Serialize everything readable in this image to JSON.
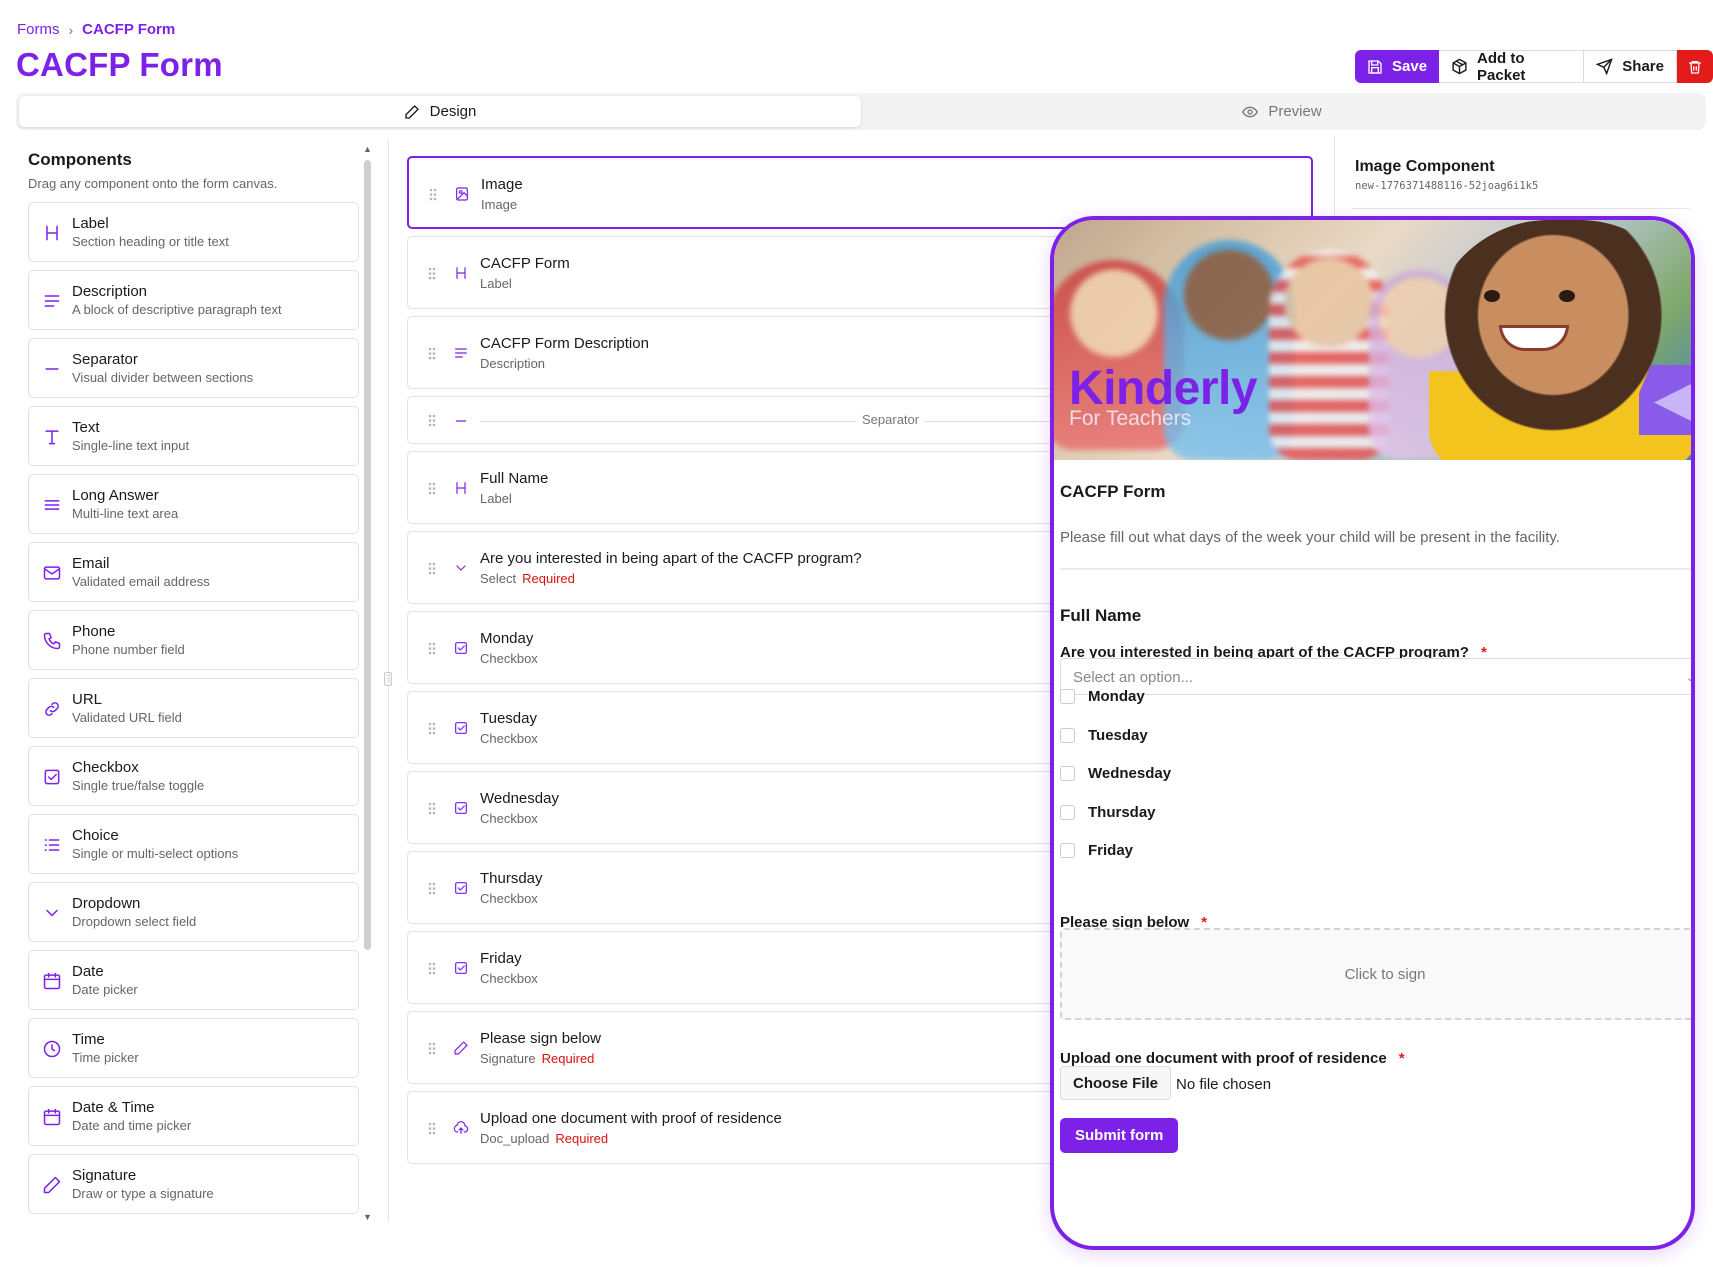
{
  "breadcrumb": {
    "parent": "Forms",
    "current": "CACFP Form"
  },
  "page_title": "CACFP Form",
  "actions": {
    "save": "Save",
    "add_to_packet": "Add to Packet",
    "share": "Share"
  },
  "tabs": {
    "design": "Design",
    "preview": "Preview",
    "active": "design"
  },
  "components": {
    "title": "Components",
    "subtitle": "Drag any component onto the form canvas.",
    "items": [
      {
        "name": "Label",
        "desc": "Section heading or title text",
        "icon": "heading-icon"
      },
      {
        "name": "Description",
        "desc": "A block of descriptive paragraph text",
        "icon": "paragraph-icon"
      },
      {
        "name": "Separator",
        "desc": "Visual divider between sections",
        "icon": "separator-icon"
      },
      {
        "name": "Text",
        "desc": "Single-line text input",
        "icon": "text-icon"
      },
      {
        "name": "Long Answer",
        "desc": "Multi-line text area",
        "icon": "lines-icon"
      },
      {
        "name": "Email",
        "desc": "Validated email address",
        "icon": "mail-icon"
      },
      {
        "name": "Phone",
        "desc": "Phone number field",
        "icon": "phone-icon"
      },
      {
        "name": "URL",
        "desc": "Validated URL field",
        "icon": "link-icon"
      },
      {
        "name": "Checkbox",
        "desc": "Single true/false toggle",
        "icon": "checkbox-icon"
      },
      {
        "name": "Choice",
        "desc": "Single or multi-select options",
        "icon": "list-icon"
      },
      {
        "name": "Dropdown",
        "desc": "Dropdown select field",
        "icon": "chevron-down-icon"
      },
      {
        "name": "Date",
        "desc": "Date picker",
        "icon": "calendar-icon"
      },
      {
        "name": "Time",
        "desc": "Time picker",
        "icon": "clock-icon"
      },
      {
        "name": "Date & Time",
        "desc": "Date and time picker",
        "icon": "calendar-icon"
      },
      {
        "name": "Signature",
        "desc": "Draw or type a signature",
        "icon": "pen-icon"
      }
    ]
  },
  "canvas": {
    "fields": [
      {
        "name": "Image",
        "type": "Image",
        "icon": "image-icon",
        "selected": true
      },
      {
        "name": "CACFP Form",
        "type": "Label",
        "icon": "heading-icon"
      },
      {
        "name": "CACFP Form Description",
        "type": "Description",
        "icon": "paragraph-icon"
      },
      {
        "separator": true,
        "type": "Separator",
        "icon": "separator-icon"
      },
      {
        "name": "Full Name",
        "type": "Label",
        "icon": "heading-icon"
      },
      {
        "name": "Are you interested in being apart of the CACFP program?",
        "type": "Select",
        "icon": "chevron-down-icon",
        "required": "Required"
      },
      {
        "name": "Monday",
        "type": "Checkbox",
        "icon": "checkbox-icon"
      },
      {
        "name": "Tuesday",
        "type": "Checkbox",
        "icon": "checkbox-icon"
      },
      {
        "name": "Wednesday",
        "type": "Checkbox",
        "icon": "checkbox-icon"
      },
      {
        "name": "Thursday",
        "type": "Checkbox",
        "icon": "checkbox-icon"
      },
      {
        "name": "Friday",
        "type": "Checkbox",
        "icon": "checkbox-icon"
      },
      {
        "name": "Please sign below",
        "type": "Signature",
        "icon": "pen-icon",
        "required": "Required"
      },
      {
        "name": "Upload one document with proof of residence",
        "type": "Doc_upload",
        "icon": "upload-icon",
        "required": "Required"
      }
    ]
  },
  "properties": {
    "title": "Image Component",
    "id": "new-1776371488116-52joag6i1k5"
  },
  "preview": {
    "banner": {
      "brand": "Kinderly",
      "tagline": "For Teachers"
    },
    "title": "CACFP Form",
    "description": "Please fill out what days of the week your child will be present in the facility.",
    "full_name": "Full Name",
    "question": "Are you interested in being apart of the CACFP program?",
    "select_placeholder": "Select an option...",
    "days": [
      "Monday",
      "Tuesday",
      "Wednesday",
      "Thursday",
      "Friday"
    ],
    "signature_label": "Please sign below",
    "signature_placeholder": "Click to sign",
    "upload_label": "Upload one document with proof of residence",
    "choose_file": "Choose File",
    "no_file": "No file chosen",
    "submit": "Submit form",
    "required_mark": "*"
  },
  "colors": {
    "accent": "#7c22e8",
    "danger": "#e31b1b",
    "required": "#dd1111"
  }
}
